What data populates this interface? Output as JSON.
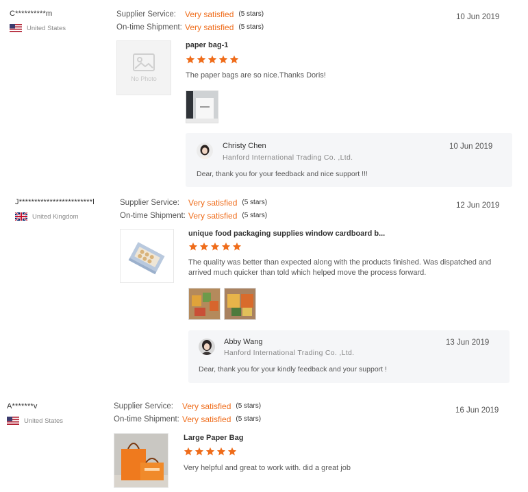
{
  "labels": {
    "supplier_service": "Supplier Service:",
    "on_time_shipment": "On-time Shipment:"
  },
  "accent_color": "#ef6c1a",
  "reviews": [
    {
      "buyer": "C**********m",
      "country": "United States",
      "flag_icon": "us-flag-icon",
      "supplier_service": "Very satisfied",
      "supplier_service_stars": "(5 stars)",
      "on_time_shipment": "Very satisfied",
      "on_time_shipment_stars": "(5 stars)",
      "date": "10 Jun 2019",
      "product_title": "paper bag-1",
      "product_image": "no-photo-placeholder",
      "no_photo_text": "No Photo",
      "rating": 5,
      "text": "The paper bags are so nice.Thanks Doris!",
      "reply": {
        "name": "Christy Chen",
        "company": "Hanford International Trading Co. ,Ltd.",
        "date": "10 Jun 2019",
        "text": "Dear, thank you for your feedback and nice support !!!"
      }
    },
    {
      "buyer": "J************************l",
      "country": "United Kingdom",
      "flag_icon": "uk-flag-icon",
      "supplier_service": "Very satisfied",
      "supplier_service_stars": "(5 stars)",
      "on_time_shipment": "Very satisfied",
      "on_time_shipment_stars": "(5 stars)",
      "date": "12 Jun 2019",
      "product_title": "unique food packaging supplies window cardboard b...",
      "product_image": "window-cardboard-box-image",
      "rating": 5,
      "text_line1": "The quality was better than expected along with the products finished. Was dispatched and",
      "text_line2": "arrived much quicker than told which helped move the process forward.",
      "reply": {
        "name": "Abby Wang",
        "company": "Hanford International Trading Co. ,Ltd.",
        "date": "13 Jun 2019",
        "text": "Dear, thank you for your kindly feedback and your support !"
      }
    },
    {
      "buyer": "A*******v",
      "country": "United States",
      "flag_icon": "us-flag-icon",
      "supplier_service": "Very satisfied",
      "supplier_service_stars": "(5 stars)",
      "on_time_shipment": "Very satisfied",
      "on_time_shipment_stars": "(5 stars)",
      "date": "16 Jun 2019",
      "product_title": "Large Paper Bag",
      "product_image": "orange-paper-bag-image",
      "rating": 5,
      "text": "Very helpful and great to work with. did a great job"
    }
  ]
}
